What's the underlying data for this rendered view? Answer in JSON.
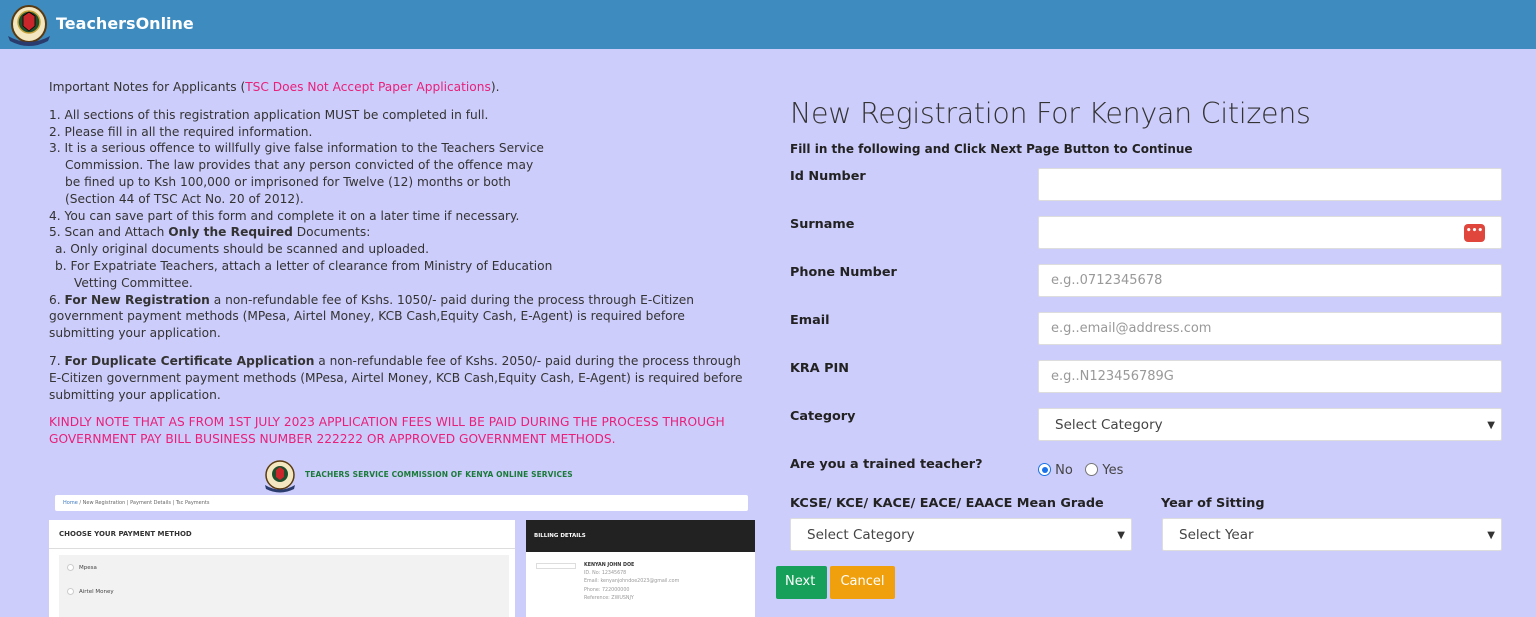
{
  "header": {
    "brand": "TeachersOnline"
  },
  "notes": {
    "intro": "Important Notes for Applicants (",
    "intro_pink": "TSC Does Not Accept Paper Applications",
    "intro_end": ").",
    "line1": "1.  All sections of this registration application MUST be completed in full.",
    "line2": "2.  Please fill in all the required information.",
    "line3a": "3.  It is a serious offence to willfully give false information to the Teachers Service",
    "line3b": "Commission. The law provides that any person convicted of the offence may",
    "line3c": "be fined up to Ksh 100,000 or imprisoned for Twelve (12) months or both",
    "line3d": "(Section 44 of TSC Act No. 20 of 2012).",
    "line4": "4.  You can save part of this form and complete it on a later time if necessary.",
    "line5_pre": "5.  Scan and Attach ",
    "line5_bold": "Only the  Required",
    "line5_post": " Documents:",
    "line5a": "a. Only original documents should be scanned and uploaded.",
    "line5b": "b. For Expatriate Teachers, attach a letter of clearance from Ministry of Education",
    "line5b2": "Vetting Committee.",
    "line6_pre": "6.  ",
    "line6_bold": "For New Registration",
    "line6_post": " a non-refundable fee of Kshs. 1050/- paid during the process through E-Citizen government payment methods (MPesa, Airtel Money, KCB Cash,Equity Cash, E-Agent) is required before submitting your application.",
    "line7_pre": "7.  ",
    "line7_bold": "For Duplicate Certificate Application",
    "line7_post": " a non-refundable fee of Kshs. 2050/- paid during the process through E-Citizen government payment methods (MPesa, Airtel Money, KCB Cash,Equity Cash, E-Agent) is required before submitting your application.",
    "kindly": "KINDLY NOTE THAT AS FROM 1ST JULY 2023 APPLICATION FEES WILL BE PAID DURING THE PROCESS THROUGH GOVERNMENT PAY BILL BUSINESS NUMBER 222222 OR APPROVED GOVERNMENT METHODS."
  },
  "preview": {
    "title": "TEACHERS SERVICE COMMISSION OF KENYA ONLINE SERVICES",
    "crumb_home": "Home",
    "crumb_rest": " /  New Registration | Payment Details | Tsc Payments",
    "pay_header": "CHOOSE YOUR PAYMENT METHOD",
    "opt1": "Mpesa",
    "opt2": "Airtel Money",
    "bill_header": "BILLING DETAILS",
    "bill_name": "KENYAN JOHN DOE",
    "bill_id": "ID. No: 12345678",
    "bill_email": "Email: kenyanjohndoe2023@gmail.com",
    "bill_phone": "Phone: 722000000",
    "bill_ref": "Reference: ZWUSNJY"
  },
  "form": {
    "title": "New Registration For Kenyan Citizens",
    "subtitle": "Fill in the following and Click Next Page Button to Continue",
    "id_label": "Id Number",
    "surname_label": "Surname",
    "phone_label": "Phone Number",
    "phone_placeholder": "e.g..0712345678",
    "email_label": "Email",
    "email_placeholder": "e.g..email@address.com",
    "kra_label": "KRA PIN",
    "kra_placeholder": "e.g..N123456789G",
    "category_label": "Category",
    "category_value": "Select Category",
    "trained_label": "Are you a trained teacher?",
    "radio_no": "No",
    "radio_yes": "Yes",
    "grade_label": "KCSE/ KCE/ KACE/ EACE/ EAACE Mean Grade",
    "grade_value": "Select Category",
    "year_label": "Year of Sitting",
    "year_value": "Select Year",
    "next_label": "Next",
    "cancel_label": "Cancel"
  },
  "colors": {
    "header_bg": "#3d8bbf",
    "page_bg": "#cdcdfb",
    "pink": "#e8207a",
    "next_green": "#16a05a",
    "cancel_orange": "#f0a00c"
  }
}
